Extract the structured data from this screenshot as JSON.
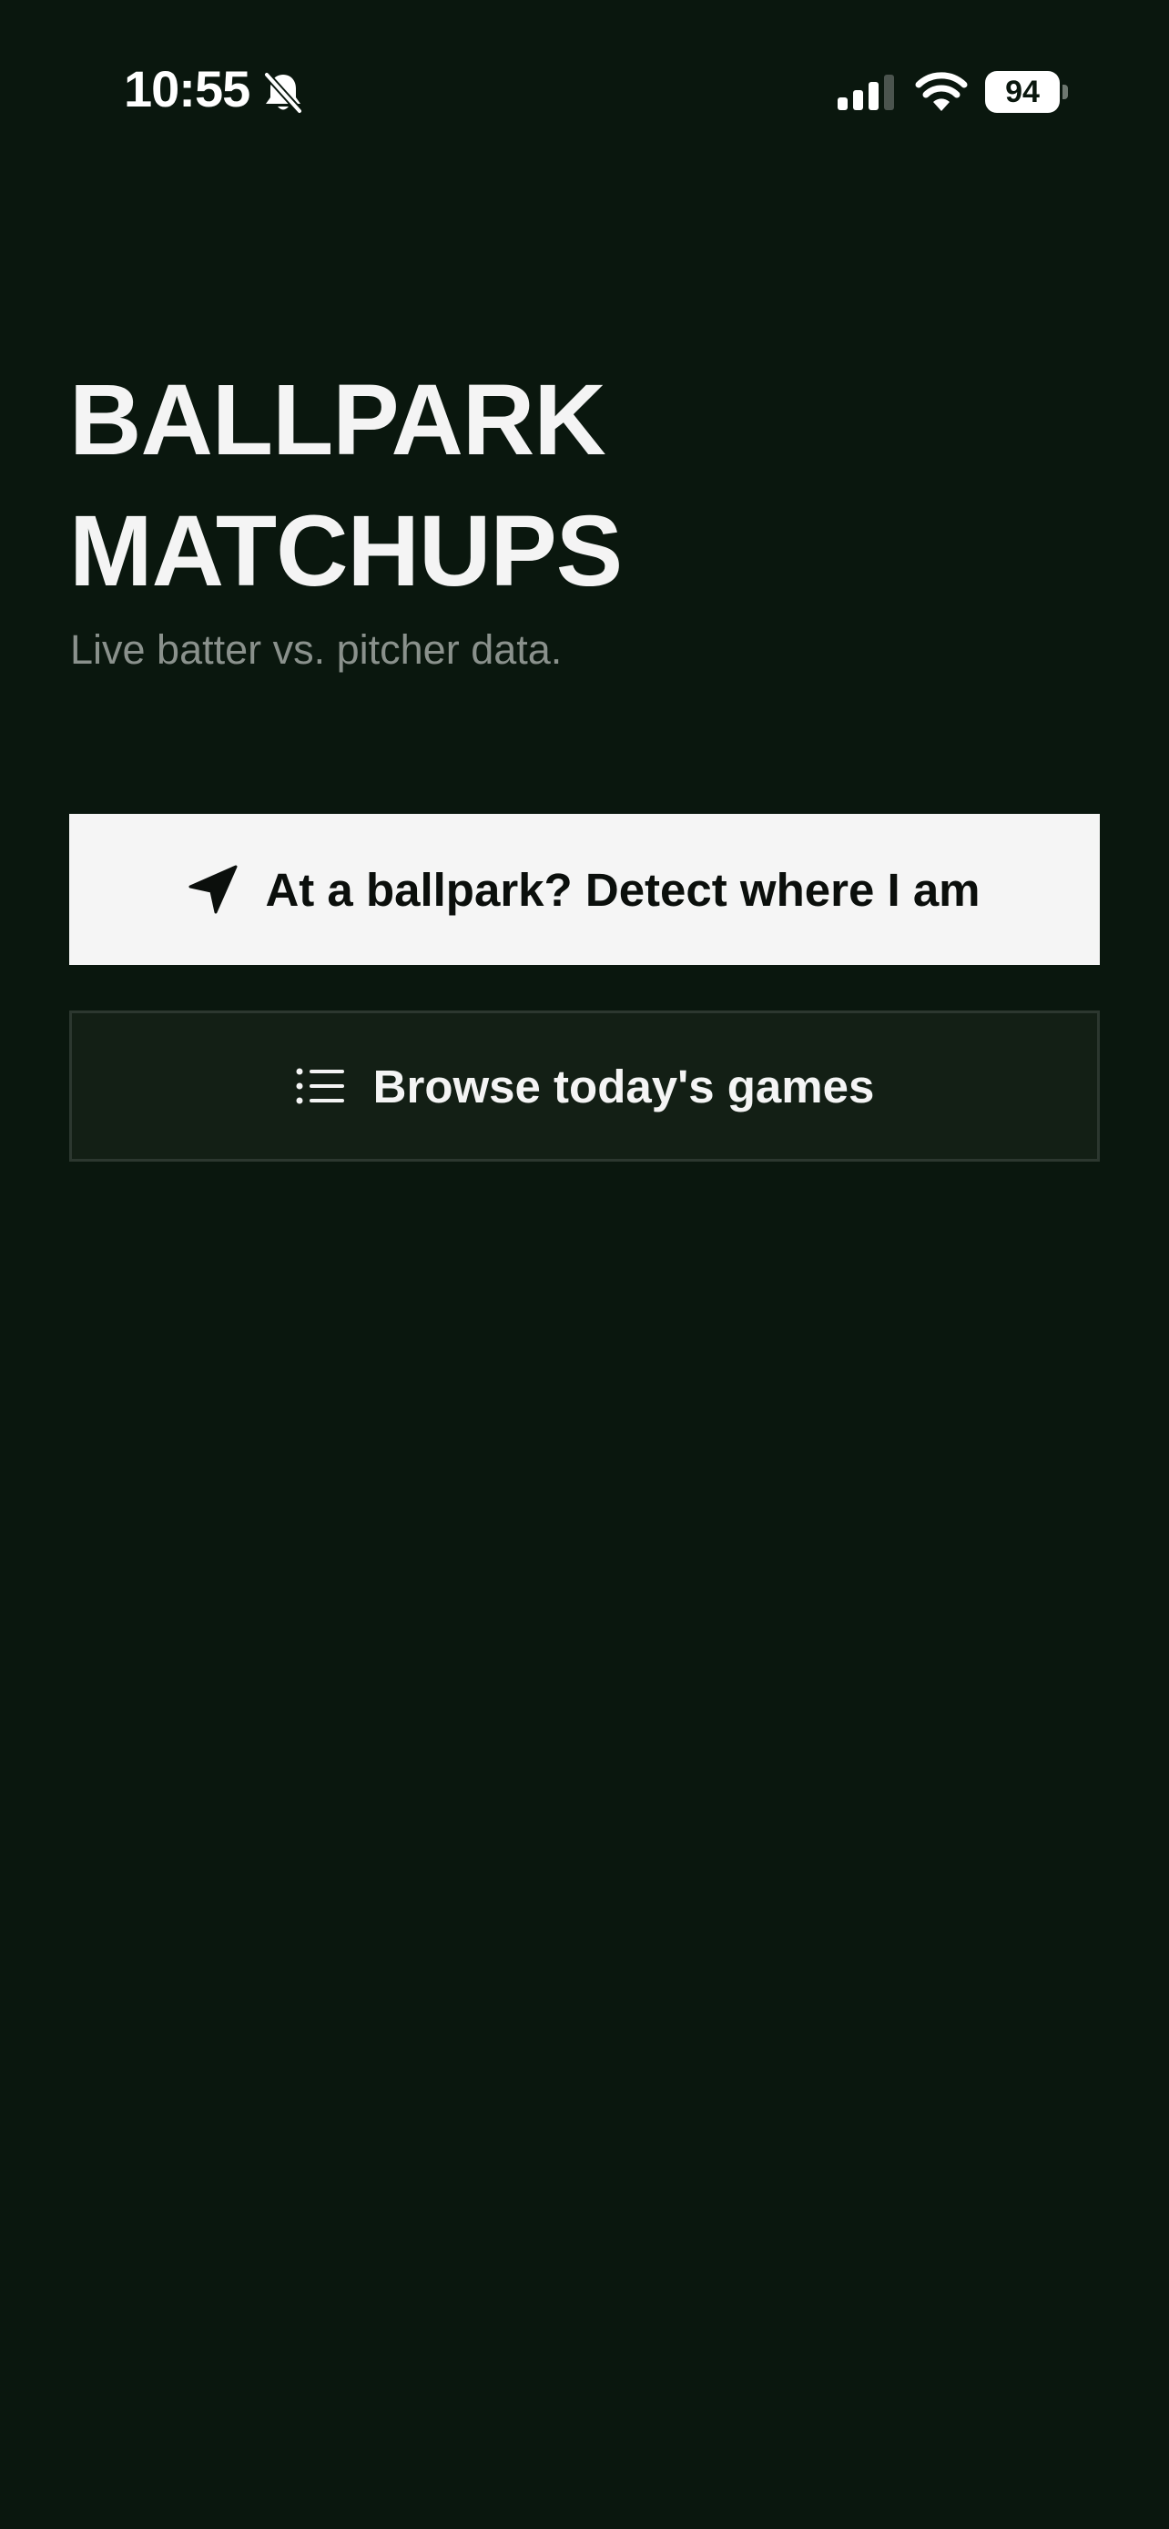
{
  "status_bar": {
    "time": "10:55",
    "battery_level": "94",
    "icons": [
      "bell-slash-icon",
      "cellular-signal-icon",
      "wifi-icon",
      "battery-icon"
    ]
  },
  "hero": {
    "title_line1": "BALLPARK",
    "title_line2": "MATCHUPS",
    "subtitle": "Live batter vs. pitcher data."
  },
  "actions": {
    "detect": {
      "label": "At a ballpark? Detect where I am",
      "icon": "location-arrow-icon"
    },
    "browse": {
      "label": "Browse today's games",
      "icon": "list-icon"
    }
  },
  "colors": {
    "background": "#0a170e",
    "primary_button": "#f5f5f5",
    "secondary_button": "#131f15",
    "secondary_border": "#2c372f",
    "subtitle": "#8a918c"
  }
}
